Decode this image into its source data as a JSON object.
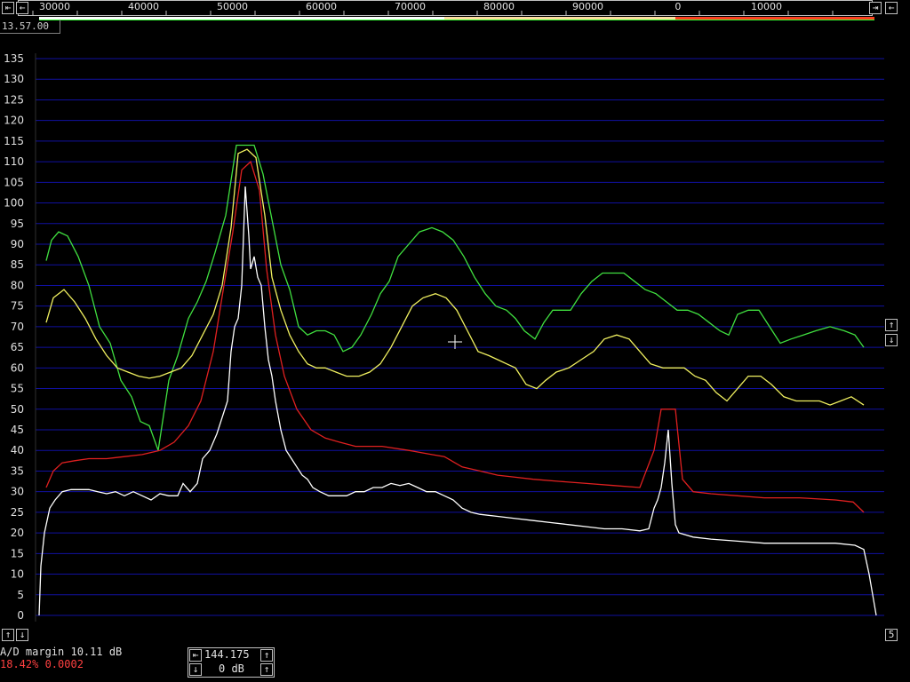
{
  "freq_scale": {
    "labels": [
      "30000",
      "40000",
      "50000",
      "60000",
      "70000",
      "80000",
      "90000",
      "0",
      "10000"
    ]
  },
  "time_label": "13.57.00",
  "chart_data": {
    "type": "line",
    "title": "",
    "xlabel": "",
    "ylabel": "",
    "yticks": [
      0,
      5,
      10,
      15,
      20,
      25,
      30,
      35,
      40,
      45,
      50,
      55,
      60,
      65,
      70,
      75,
      80,
      85,
      90,
      95,
      100,
      105,
      110,
      115,
      120,
      125,
      130,
      135
    ],
    "ylim": [
      0,
      135
    ],
    "grid": true,
    "series": [
      {
        "color": "#40e040",
        "values": [
          [
            52,
            86
          ],
          [
            58,
            91
          ],
          [
            66,
            93
          ],
          [
            76,
            92
          ],
          [
            88,
            87
          ],
          [
            100,
            80
          ],
          [
            112,
            70
          ],
          [
            124,
            66
          ],
          [
            136,
            57
          ],
          [
            148,
            53
          ],
          [
            158,
            47
          ],
          [
            168,
            46
          ],
          [
            178,
            40
          ],
          [
            190,
            57
          ],
          [
            200,
            63
          ],
          [
            212,
            72
          ],
          [
            222,
            76
          ],
          [
            232,
            81
          ],
          [
            242,
            88
          ],
          [
            254,
            97
          ],
          [
            266,
            114
          ],
          [
            276,
            114
          ],
          [
            286,
            114
          ],
          [
            296,
            107
          ],
          [
            306,
            96
          ],
          [
            316,
            85
          ],
          [
            326,
            79
          ],
          [
            336,
            70
          ],
          [
            346,
            68
          ],
          [
            356,
            69
          ],
          [
            366,
            69
          ],
          [
            376,
            68
          ],
          [
            386,
            64
          ],
          [
            396,
            65
          ],
          [
            406,
            68
          ],
          [
            418,
            73
          ],
          [
            428,
            78
          ],
          [
            438,
            81
          ],
          [
            448,
            87
          ],
          [
            460,
            90
          ],
          [
            472,
            93
          ],
          [
            486,
            94
          ],
          [
            498,
            93
          ],
          [
            510,
            91
          ],
          [
            522,
            87
          ],
          [
            534,
            82
          ],
          [
            546,
            78
          ],
          [
            558,
            75
          ],
          [
            570,
            74
          ],
          [
            580,
            72
          ],
          [
            590,
            69
          ],
          [
            602,
            67
          ],
          [
            612,
            71
          ],
          [
            622,
            74
          ],
          [
            632,
            74
          ],
          [
            642,
            74
          ],
          [
            654,
            78
          ],
          [
            666,
            81
          ],
          [
            678,
            83
          ],
          [
            690,
            83
          ],
          [
            702,
            83
          ],
          [
            714,
            81
          ],
          [
            726,
            79
          ],
          [
            738,
            78
          ],
          [
            750,
            76
          ],
          [
            762,
            74
          ],
          [
            774,
            74
          ],
          [
            786,
            73
          ],
          [
            798,
            71
          ],
          [
            810,
            69
          ],
          [
            820,
            68
          ],
          [
            830,
            73
          ],
          [
            842,
            74
          ],
          [
            854,
            74
          ],
          [
            866,
            70
          ],
          [
            878,
            66
          ],
          [
            890,
            67
          ],
          [
            904,
            68
          ],
          [
            918,
            69
          ],
          [
            934,
            70
          ],
          [
            950,
            69
          ],
          [
            962,
            68
          ],
          [
            972,
            65
          ]
        ]
      },
      {
        "color": "#f0f060",
        "values": [
          [
            52,
            71
          ],
          [
            60,
            77
          ],
          [
            72,
            79
          ],
          [
            84,
            76
          ],
          [
            96,
            72
          ],
          [
            108,
            67
          ],
          [
            120,
            63
          ],
          [
            132,
            60
          ],
          [
            144,
            59
          ],
          [
            156,
            58
          ],
          [
            168,
            57.5
          ],
          [
            180,
            58
          ],
          [
            192,
            59
          ],
          [
            204,
            60
          ],
          [
            216,
            63
          ],
          [
            228,
            68
          ],
          [
            240,
            73
          ],
          [
            250,
            80
          ],
          [
            260,
            94
          ],
          [
            268,
            112
          ],
          [
            278,
            113
          ],
          [
            288,
            111
          ],
          [
            298,
            97
          ],
          [
            306,
            82
          ],
          [
            316,
            74
          ],
          [
            326,
            68
          ],
          [
            336,
            64
          ],
          [
            346,
            61
          ],
          [
            356,
            60
          ],
          [
            366,
            60
          ],
          [
            378,
            59
          ],
          [
            390,
            58
          ],
          [
            404,
            58
          ],
          [
            416,
            59
          ],
          [
            428,
            61
          ],
          [
            440,
            65
          ],
          [
            452,
            70
          ],
          [
            464,
            75
          ],
          [
            476,
            77
          ],
          [
            490,
            78
          ],
          [
            502,
            77
          ],
          [
            514,
            74
          ],
          [
            526,
            69
          ],
          [
            538,
            64
          ],
          [
            550,
            63
          ],
          [
            560,
            62
          ],
          [
            570,
            61
          ],
          [
            580,
            60
          ],
          [
            592,
            56
          ],
          [
            604,
            55
          ],
          [
            614,
            57
          ],
          [
            626,
            59
          ],
          [
            640,
            60
          ],
          [
            654,
            62
          ],
          [
            668,
            64
          ],
          [
            680,
            67
          ],
          [
            694,
            68
          ],
          [
            708,
            67
          ],
          [
            720,
            64
          ],
          [
            732,
            61
          ],
          [
            746,
            60
          ],
          [
            758,
            60
          ],
          [
            770,
            60
          ],
          [
            782,
            58
          ],
          [
            794,
            57
          ],
          [
            806,
            54
          ],
          [
            818,
            52
          ],
          [
            830,
            55
          ],
          [
            842,
            58
          ],
          [
            856,
            58
          ],
          [
            868,
            56
          ],
          [
            882,
            53
          ],
          [
            896,
            52
          ],
          [
            910,
            52
          ],
          [
            922,
            52
          ],
          [
            934,
            51
          ],
          [
            946,
            52
          ],
          [
            958,
            53
          ],
          [
            972,
            51
          ]
        ]
      },
      {
        "color": "#e02020",
        "values": [
          [
            52,
            31
          ],
          [
            60,
            35
          ],
          [
            70,
            37
          ],
          [
            84,
            37.5
          ],
          [
            100,
            38
          ],
          [
            120,
            38
          ],
          [
            140,
            38.5
          ],
          [
            160,
            39
          ],
          [
            180,
            40
          ],
          [
            196,
            42
          ],
          [
            212,
            46
          ],
          [
            226,
            52
          ],
          [
            240,
            64
          ],
          [
            252,
            80
          ],
          [
            262,
            93
          ],
          [
            272,
            108
          ],
          [
            282,
            110
          ],
          [
            292,
            103
          ],
          [
            300,
            84
          ],
          [
            310,
            68
          ],
          [
            320,
            58
          ],
          [
            334,
            50
          ],
          [
            350,
            45
          ],
          [
            366,
            43
          ],
          [
            382,
            42
          ],
          [
            400,
            41
          ],
          [
            430,
            41
          ],
          [
            460,
            40
          ],
          [
            486,
            39
          ],
          [
            500,
            38.5
          ],
          [
            520,
            36
          ],
          [
            540,
            35
          ],
          [
            560,
            34
          ],
          [
            580,
            33.5
          ],
          [
            600,
            33
          ],
          [
            630,
            32.5
          ],
          [
            660,
            32
          ],
          [
            690,
            31.5
          ],
          [
            720,
            31
          ],
          [
            736,
            40
          ],
          [
            744,
            50
          ],
          [
            752,
            50
          ],
          [
            760,
            50
          ],
          [
            768,
            33
          ],
          [
            780,
            30
          ],
          [
            800,
            29.5
          ],
          [
            830,
            29
          ],
          [
            860,
            28.5
          ],
          [
            900,
            28.5
          ],
          [
            940,
            28
          ],
          [
            960,
            27.5
          ],
          [
            972,
            25
          ]
        ]
      },
      {
        "color": "#ffffff",
        "values": [
          [
            44,
            0
          ],
          [
            46,
            12
          ],
          [
            50,
            20
          ],
          [
            56,
            26
          ],
          [
            62,
            28
          ],
          [
            70,
            30
          ],
          [
            80,
            30.5
          ],
          [
            90,
            30.5
          ],
          [
            100,
            30.5
          ],
          [
            110,
            30
          ],
          [
            120,
            29.5
          ],
          [
            130,
            30
          ],
          [
            140,
            29
          ],
          [
            150,
            30
          ],
          [
            160,
            29
          ],
          [
            170,
            28
          ],
          [
            180,
            29.5
          ],
          [
            190,
            29
          ],
          [
            200,
            29
          ],
          [
            206,
            32
          ],
          [
            214,
            30
          ],
          [
            222,
            32
          ],
          [
            228,
            38
          ],
          [
            236,
            40
          ],
          [
            244,
            44
          ],
          [
            250,
            48
          ],
          [
            256,
            52
          ],
          [
            260,
            64
          ],
          [
            264,
            70
          ],
          [
            268,
            72
          ],
          [
            272,
            80
          ],
          [
            276,
            104
          ],
          [
            278,
            98
          ],
          [
            280,
            92
          ],
          [
            282,
            84
          ],
          [
            286,
            87
          ],
          [
            290,
            82
          ],
          [
            294,
            80
          ],
          [
            298,
            70
          ],
          [
            302,
            62
          ],
          [
            306,
            58
          ],
          [
            310,
            52
          ],
          [
            316,
            45
          ],
          [
            322,
            40
          ],
          [
            328,
            38
          ],
          [
            334,
            36
          ],
          [
            340,
            34
          ],
          [
            346,
            33
          ],
          [
            352,
            31
          ],
          [
            360,
            30
          ],
          [
            370,
            29
          ],
          [
            380,
            29
          ],
          [
            390,
            29
          ],
          [
            400,
            30
          ],
          [
            410,
            30
          ],
          [
            420,
            31
          ],
          [
            430,
            31
          ],
          [
            440,
            32
          ],
          [
            450,
            31.5
          ],
          [
            460,
            32
          ],
          [
            470,
            31
          ],
          [
            480,
            30
          ],
          [
            490,
            30
          ],
          [
            500,
            29
          ],
          [
            510,
            28
          ],
          [
            520,
            26
          ],
          [
            530,
            25
          ],
          [
            540,
            24.5
          ],
          [
            560,
            24
          ],
          [
            580,
            23.5
          ],
          [
            600,
            23
          ],
          [
            620,
            22.5
          ],
          [
            640,
            22
          ],
          [
            660,
            21.5
          ],
          [
            680,
            21
          ],
          [
            700,
            21
          ],
          [
            720,
            20.5
          ],
          [
            730,
            21
          ],
          [
            736,
            26
          ],
          [
            740,
            28
          ],
          [
            744,
            31
          ],
          [
            748,
            37
          ],
          [
            752,
            45
          ],
          [
            756,
            32
          ],
          [
            760,
            22
          ],
          [
            764,
            20
          ],
          [
            780,
            19
          ],
          [
            800,
            18.5
          ],
          [
            830,
            18
          ],
          [
            860,
            17.5
          ],
          [
            900,
            17.5
          ],
          [
            940,
            17.5
          ],
          [
            962,
            17
          ],
          [
            972,
            16
          ],
          [
            978,
            10
          ],
          [
            982,
            5
          ],
          [
            986,
            0
          ]
        ]
      }
    ]
  },
  "status": {
    "ad_margin": "A/D margin 10.11 dB",
    "stats": "18.42% 0.0002",
    "freq_value": "144.175",
    "gain_value": "0 dB",
    "right_number": "5"
  },
  "colors": {
    "grid": "#1010a0",
    "frame": "#c0c0c0",
    "stats_text": "#ff4040"
  }
}
